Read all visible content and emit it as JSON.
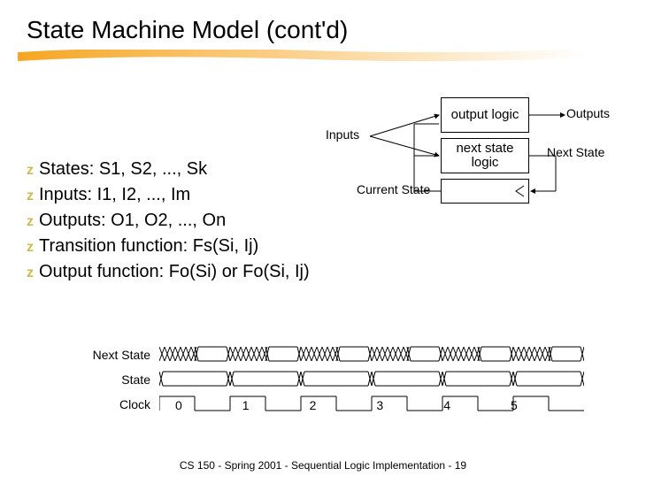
{
  "title": "State Machine Model (cont'd)",
  "diagram": {
    "inputs_label": "Inputs",
    "outputs_label": "Outputs",
    "next_state_label": "Next State",
    "current_state_label": "Current State",
    "output_logic_box": "output logic",
    "next_state_logic_box": "next state logic"
  },
  "bullets": [
    "States: S1, S2, ..., Sk",
    "Inputs: I1, I2, ..., Im",
    "Outputs: O1, O2, ..., On",
    "Transition function: Fs(Si, Ij)",
    "Output function: Fo(Si) or Fo(Si, Ij)"
  ],
  "timing": {
    "rows": [
      "Next State",
      "State",
      "Clock"
    ],
    "ticks": [
      "0",
      "1",
      "2",
      "3",
      "4",
      "5"
    ]
  },
  "footer": "CS 150 - Spring  2001 - Sequential Logic Implementation - 19"
}
